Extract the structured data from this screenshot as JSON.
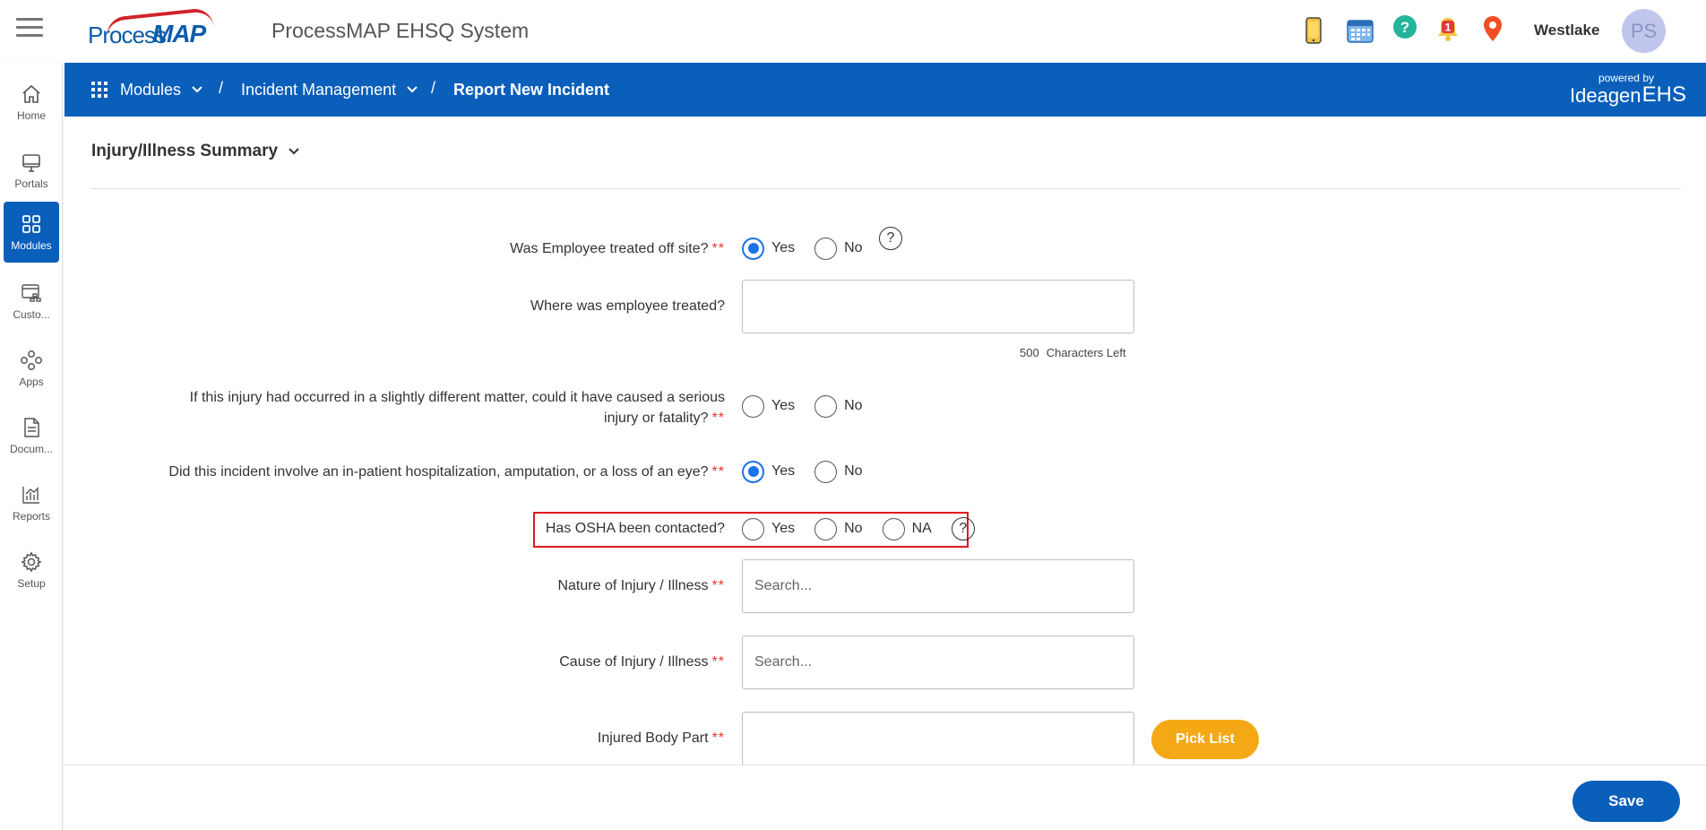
{
  "header": {
    "logo_part1": "Process",
    "logo_part2": "MAP",
    "app_title": "ProcessMAP EHSQ System",
    "user_name": "Westlake",
    "avatar_initials": "PS",
    "notification_count": "1",
    "icons": [
      "mobile-icon",
      "calendar-icon",
      "help-icon",
      "notification-bell-icon",
      "location-pin-icon"
    ]
  },
  "sidebar": {
    "items": [
      {
        "label": "Home",
        "icon": "home-icon"
      },
      {
        "label": "Portals",
        "icon": "monitor-icon"
      },
      {
        "label": "Modules",
        "icon": "grid-icon",
        "active": true
      },
      {
        "label": "Custo...",
        "icon": "custom-icon"
      },
      {
        "label": "Apps",
        "icon": "apps-icon"
      },
      {
        "label": "Docum...",
        "icon": "document-icon"
      },
      {
        "label": "Reports",
        "icon": "chart-icon"
      },
      {
        "label": "Setup",
        "icon": "gear-icon"
      }
    ]
  },
  "breadcrumb": {
    "modules": "Modules",
    "incident_management": "Incident Management",
    "current": "Report New Incident",
    "separator": "/",
    "powered_by": "powered by",
    "brand": "Ideagen",
    "brand_suffix": "EHS"
  },
  "section": {
    "title": "Injury/Illness Summary"
  },
  "form": {
    "required_marker": "**",
    "q_treated_offsite": {
      "label": "Was Employee treated off site?",
      "yes": "Yes",
      "no": "No",
      "selected": "Yes",
      "help": "?"
    },
    "q_where_treated": {
      "label": "Where was employee treated?",
      "value": "",
      "chars_left": "500",
      "chars_left_label": "Characters Left"
    },
    "q_serious": {
      "label_line1": "If this injury had occurred in a slightly different matter, could it have caused a serious",
      "label_line2": "injury or fatality?",
      "yes": "Yes",
      "no": "No",
      "selected": ""
    },
    "q_hospitalization": {
      "label": "Did this incident involve an in-patient hospitalization, amputation, or a loss of an eye?",
      "yes": "Yes",
      "no": "No",
      "selected": "Yes"
    },
    "q_osha": {
      "label": "Has OSHA been contacted?",
      "yes": "Yes",
      "no": "No",
      "na": "NA",
      "selected": "",
      "help": "?"
    },
    "q_nature": {
      "label": "Nature of Injury / Illness",
      "placeholder": "Search..."
    },
    "q_cause": {
      "label": "Cause of Injury / Illness",
      "placeholder": "Search..."
    },
    "q_body_part": {
      "label": "Injured Body Part",
      "value": "",
      "pick_list": "Pick List"
    }
  },
  "footer": {
    "save_label": "Save"
  },
  "colors": {
    "primary_blue": "#0a5fbb",
    "radio_blue": "#1a73e8",
    "required_red": "#e53935",
    "highlight_red": "#e0161e",
    "pick_list_orange": "#f5a815"
  }
}
